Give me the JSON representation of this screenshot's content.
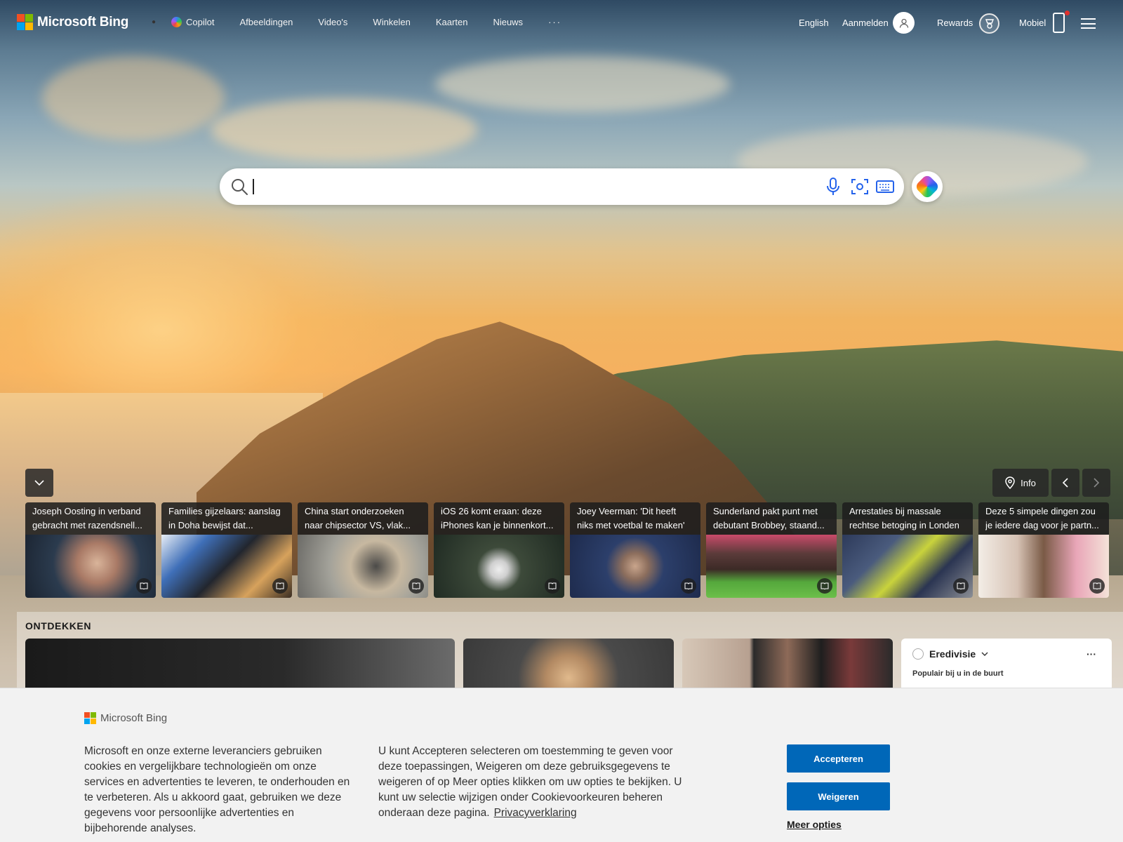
{
  "brand": {
    "name": "Microsoft Bing"
  },
  "nav": {
    "items": [
      {
        "label": "Copilot"
      },
      {
        "label": "Afbeeldingen"
      },
      {
        "label": "Video's"
      },
      {
        "label": "Winkelen"
      },
      {
        "label": "Kaarten"
      },
      {
        "label": "Nieuws"
      }
    ],
    "more_label": "···",
    "language": "English",
    "signin": "Aanmelden",
    "rewards": "Rewards",
    "mobile": "Mobiel"
  },
  "search": {
    "value": "",
    "placeholder": ""
  },
  "carousel": {
    "info_label": "Info"
  },
  "news": [
    {
      "title": "Joseph Oosting in verband gebracht met razendsnell..."
    },
    {
      "title": "Families gijzelaars: aanslag in Doha bewijst dat..."
    },
    {
      "title": "China start onderzoeken naar chipsector VS, vlak..."
    },
    {
      "title": "iOS 26 komt eraan: deze iPhones kan je binnenkort..."
    },
    {
      "title": "Joey Veerman: 'Dit heeft niks met voetbal te maken'"
    },
    {
      "title": "Sunderland pakt punt met debutant Brobbey, staand..."
    },
    {
      "title": "Arrestaties bij massale rechtse betoging in Londen"
    },
    {
      "title": "Deze 5 simpele dingen zou je iedere dag voor je partn..."
    }
  ],
  "discover": {
    "title": "ONTDEKKEN",
    "widget": {
      "title": "Eredivisie",
      "subtitle": "Populair bij u in de buurt",
      "more": "···"
    }
  },
  "cookie": {
    "brand": "Microsoft Bing",
    "text1": "Microsoft en onze externe leveranciers gebruiken cookies en vergelijkbare technologieën om onze services en advertenties te leveren, te onderhouden en te verbeteren. Als u akkoord gaat, gebruiken we deze gegevens voor persoonlijke advertenties en bijbehorende analyses.",
    "text2": "U kunt Accepteren selecteren om toestemming te geven voor deze toepassingen, Weigeren om deze gebruiksgegevens te weigeren of op Meer opties klikken om uw opties te bekijken. U kunt uw selectie wijzigen onder Cookievoorkeuren beheren onderaan deze pagina.",
    "privacy_link": "Privacyverklaring",
    "accept": "Accepteren",
    "reject": "Weigeren",
    "more": "Meer opties"
  },
  "colors": {
    "primary_button": "#0067b8",
    "cookie_bg": "#f2f2f2"
  }
}
